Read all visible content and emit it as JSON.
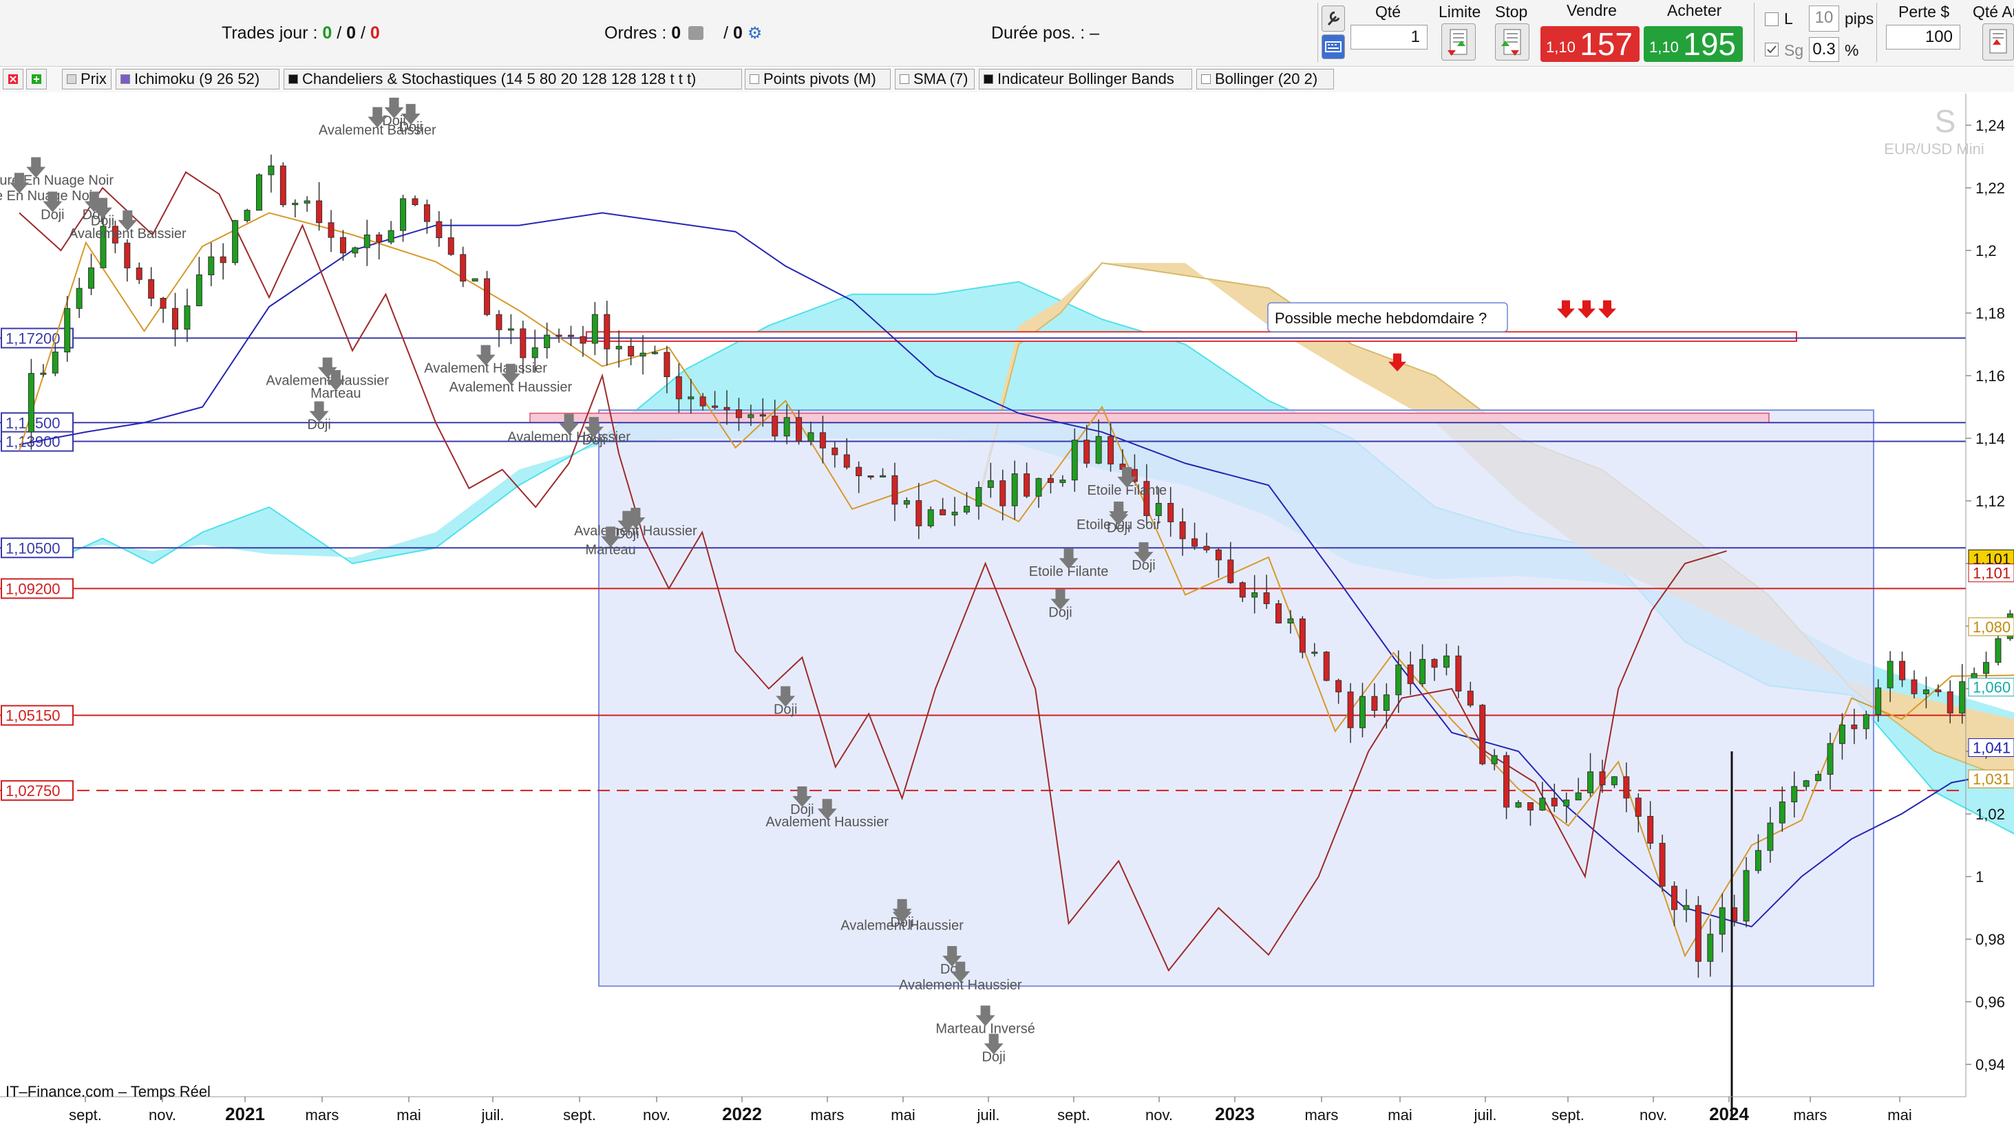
{
  "toolbar": {
    "trades_label": "Trades jour :",
    "trades_a": "0",
    "trades_sep1": "/",
    "trades_b": "0",
    "trades_sep2": "/",
    "trades_c": "0",
    "orders_label": "Ordres :",
    "orders_a": "0",
    "orders_sep": "/",
    "orders_b": "0",
    "duration_label": "Durée pos. :",
    "duration_value": "–",
    "qty_label": "Qté",
    "qty_value": "1",
    "limit_label": "Limite",
    "stop_label": "Stop",
    "sell_label": "Vendre",
    "sell_small": "1,10",
    "sell_big": "157",
    "buy_label": "Acheter",
    "buy_small": "1,10",
    "buy_big": "195",
    "l_label": "L",
    "pips_value": "10",
    "pips_label": "pips",
    "sg_label": "Sg",
    "pct_value": "0.3",
    "pct_label": "%",
    "loss_label": "Perte $",
    "loss_value": "100",
    "qty_auto_label": "Qté Au",
    "colors": {
      "sell": "#de2d2d",
      "buy": "#23a23a"
    }
  },
  "indicators": [
    {
      "label": "Prix",
      "color": "#d8d8d8"
    },
    {
      "label": "Ichimoku (9 26 52)",
      "color": "#7a5cc8"
    },
    {
      "label": "Chandeliers & Stochastiques (14 5 80 20 128 128 128 t t t)",
      "color": "#111111"
    },
    {
      "label": "Points pivots (M)",
      "color": "#ffffff"
    },
    {
      "label": "SMA (7)",
      "color": "#ffffff"
    },
    {
      "label": "Indicateur Bollinger Bands",
      "color": "#111111"
    },
    {
      "label": "Bollinger (20 2)",
      "color": "#ffffff"
    }
  ],
  "chart": {
    "instrument": "EUR/USD Mini",
    "watermark": "S",
    "y_ticks": [
      "1,24",
      "1,22",
      "1,2",
      "1,18",
      "1,16",
      "1,14",
      "1,12",
      "1,1",
      "1,08",
      "1,06",
      "1,04",
      "1,02",
      "1",
      "0,98",
      "0,96",
      "0,94"
    ],
    "x_ticks": [
      "sept.",
      "nov.",
      "2021",
      "mars",
      "mai",
      "juil.",
      "sept.",
      "nov.",
      "2022",
      "mars",
      "mai",
      "juil.",
      "sept.",
      "nov.",
      "2023",
      "mars",
      "mai",
      "juil.",
      "sept.",
      "nov.",
      "2024",
      "mars",
      "mai"
    ],
    "h_levels": [
      {
        "label": "1,17200",
        "value": 1.172,
        "color": "#3a3aa8"
      },
      {
        "label": "1,14500",
        "value": 1.145,
        "color": "#3a3aa8"
      },
      {
        "label": "1,13900",
        "value": 1.139,
        "color": "#3a3aa8"
      },
      {
        "label": "1,10500",
        "value": 1.105,
        "color": "#3a3aa8"
      },
      {
        "label": "1,09200",
        "value": 1.092,
        "color": "#d02020"
      },
      {
        "label": "1,05150",
        "value": 1.0515,
        "color": "#d02020"
      },
      {
        "label": "1,02750",
        "value": 1.0275,
        "color": "#d02020",
        "dashed": true
      }
    ],
    "right_badges": [
      {
        "label": "1,101",
        "value": 1.1015,
        "bg": "#f5d100",
        "fg": "#111111"
      },
      {
        "label": "1,101",
        "value": 1.097,
        "bg": "#ffffff",
        "fg": "#c01010"
      },
      {
        "label": "1,080",
        "value": 1.0798,
        "bg": "#ffffff",
        "fg": "#c08a10"
      },
      {
        "label": "1,060",
        "value": 1.0605,
        "bg": "#ffffff",
        "fg": "#1aa8a8"
      },
      {
        "label": "1,041",
        "value": 1.0412,
        "bg": "#ffffff",
        "fg": "#2020b0"
      },
      {
        "label": "1,031",
        "value": 1.0312,
        "bg": "#ffffff",
        "fg": "#c08a10"
      }
    ],
    "annotation": "Possible meche hebdomdaire ?",
    "footer": "IT–Finance.com – Temps Réel",
    "patterns": [
      {
        "text": "Doji",
        "x": 36,
        "y": 1.143
      },
      {
        "text": "Ouverture En Nuage Noir",
        "x": 2,
        "y": 1.221
      },
      {
        "text": "Ouverture En Nuage Noir",
        "x": 0,
        "y": 1.216
      },
      {
        "text": "Doji",
        "x": 4,
        "y": 1.21
      },
      {
        "text": "Doji",
        "x": 9,
        "y": 1.21
      },
      {
        "text": "Doji",
        "x": 10,
        "y": 1.208
      },
      {
        "text": "Avalement Baissier",
        "x": 13,
        "y": 1.204
      },
      {
        "text": "Doji",
        "x": 47,
        "y": 1.238
      },
      {
        "text": "Doji",
        "x": 45,
        "y": 1.24
      },
      {
        "text": "Avalement Baissier",
        "x": 43,
        "y": 1.237
      },
      {
        "text": "Avalement Haussier",
        "x": 37,
        "y": 1.157
      },
      {
        "text": "Marteau",
        "x": 38,
        "y": 1.153
      },
      {
        "text": "Avalement Haussier",
        "x": 56,
        "y": 1.161
      },
      {
        "text": "Avalement Haussier",
        "x": 59,
        "y": 1.155
      },
      {
        "text": "Avalement Haussier",
        "x": 66,
        "y": 1.139
      },
      {
        "text": "Doji",
        "x": 69,
        "y": 1.138
      },
      {
        "text": "Avalement Haussier",
        "x": 74,
        "y": 1.109
      },
      {
        "text": "Doji",
        "x": 73,
        "y": 1.108
      },
      {
        "text": "Marteau",
        "x": 71,
        "y": 1.103
      },
      {
        "text": "Doji",
        "x": 92,
        "y": 1.052
      },
      {
        "text": "Doji",
        "x": 94,
        "y": 1.02
      },
      {
        "text": "Avalement Haussier",
        "x": 97,
        "y": 1.016
      },
      {
        "text": "Doji",
        "x": 106,
        "y": 0.984
      },
      {
        "text": "Avalement Haussier",
        "x": 106,
        "y": 0.983
      },
      {
        "text": "Doji",
        "x": 112,
        "y": 0.969
      },
      {
        "text": "Avalement Haussier",
        "x": 113,
        "y": 0.964
      },
      {
        "text": "Marteau Inversé",
        "x": 116,
        "y": 0.95
      },
      {
        "text": "Doji",
        "x": 117,
        "y": 0.941
      },
      {
        "text": "Doji",
        "x": 125,
        "y": 1.083
      },
      {
        "text": "Etoile Filante",
        "x": 126,
        "y": 1.096
      },
      {
        "text": "Etoile Filante",
        "x": 133,
        "y": 1.122
      },
      {
        "text": "Etoile Du Soir",
        "x": 132,
        "y": 1.111
      },
      {
        "text": "Doji",
        "x": 132,
        "y": 1.11
      },
      {
        "text": "Doji",
        "x": 135,
        "y": 1.098
      }
    ],
    "colors": {
      "up": "#1f9e1f",
      "down": "#d22323",
      "kijun": "#2525b5",
      "tenkan": "#d69a2a",
      "chikou": "#9e2a2a",
      "kumo_bull": "#aef0f7",
      "kumo_bear": "#f0d9a6",
      "zone": "#dde4fb"
    }
  }
}
